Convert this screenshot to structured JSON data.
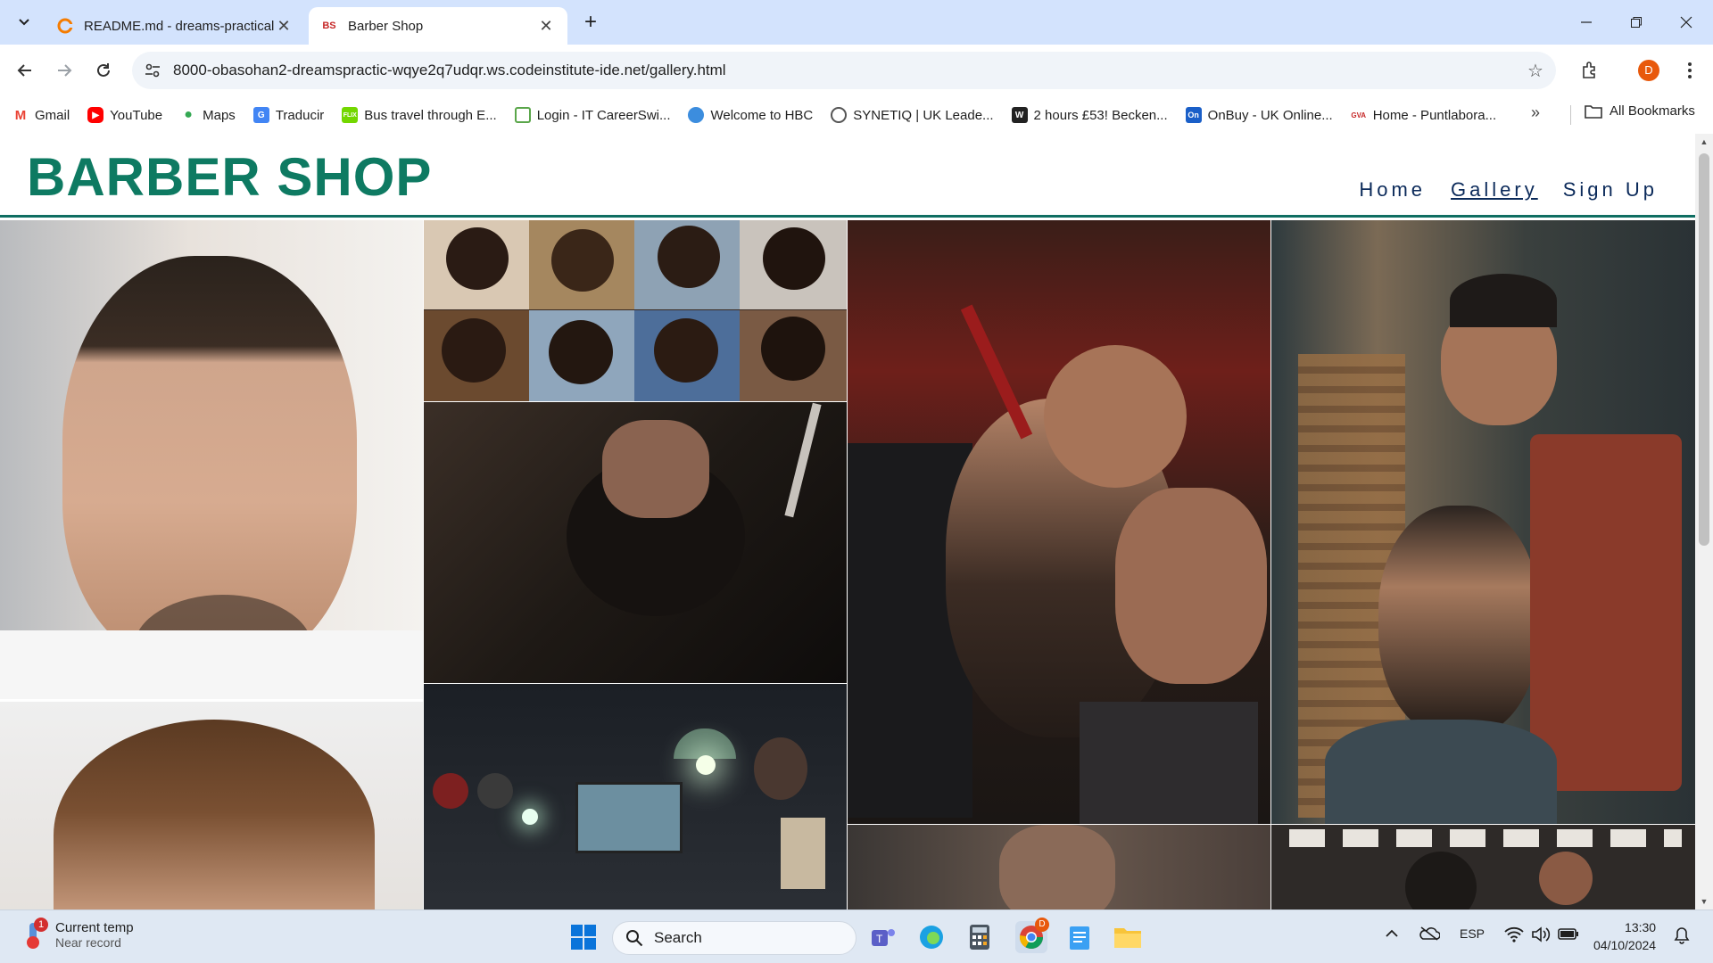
{
  "browser": {
    "tabs": [
      {
        "title": "README.md - dreams-practical",
        "active": false
      },
      {
        "title": "Barber Shop",
        "active": true,
        "favicon_text": "BS"
      }
    ],
    "url": "8000-obasohan2-dreamspractic-wqye2q7udqr.ws.codeinstitute-ide.net/gallery.html",
    "profile_initial": "D",
    "bookmarks": [
      {
        "label": "Gmail",
        "icon": "gmail-icon",
        "color": "#ea4335"
      },
      {
        "label": "YouTube",
        "icon": "youtube-icon",
        "color": "#ff0000"
      },
      {
        "label": "Maps",
        "icon": "maps-icon",
        "color": "#34a853"
      },
      {
        "label": "Traducir",
        "icon": "translate-icon",
        "color": "#4285f4"
      },
      {
        "label": "Bus travel through E...",
        "icon": "flixbus-icon",
        "color": "#73d700"
      },
      {
        "label": "Login - IT CareerSwi...",
        "icon": "careerswitch-icon",
        "color": "#5aa64a"
      },
      {
        "label": "Welcome to HBC",
        "icon": "globe-icon",
        "color": "#3c8dde"
      },
      {
        "label": "SYNETIQ | UK Leade...",
        "icon": "synetiq-icon",
        "color": "#555555"
      },
      {
        "label": "2 hours £53! Becken...",
        "icon": "w-icon",
        "color": "#222222"
      },
      {
        "label": "OnBuy - UK Online...",
        "icon": "onbuy-icon",
        "color": "#1a5fc8"
      },
      {
        "label": "Home - Puntlabora...",
        "icon": "gva-icon",
        "color": "#c62828"
      }
    ],
    "all_bookmarks": "All Bookmarks"
  },
  "site": {
    "logo": "BARBER SHOP",
    "nav": [
      {
        "label": "Home",
        "current": false
      },
      {
        "label": "Gallery",
        "current": true
      },
      {
        "label": "Sign Up",
        "current": false
      }
    ],
    "brand_color": "#0e7a62",
    "nav_color": "#0b2a5a"
  },
  "taskbar": {
    "weather_title": "Current temp",
    "weather_subtitle": "Near record",
    "weather_badge": "1",
    "search_placeholder": "Search",
    "language": "ESP",
    "time": "13:30",
    "date": "04/10/2024",
    "chrome_badge": "D"
  }
}
